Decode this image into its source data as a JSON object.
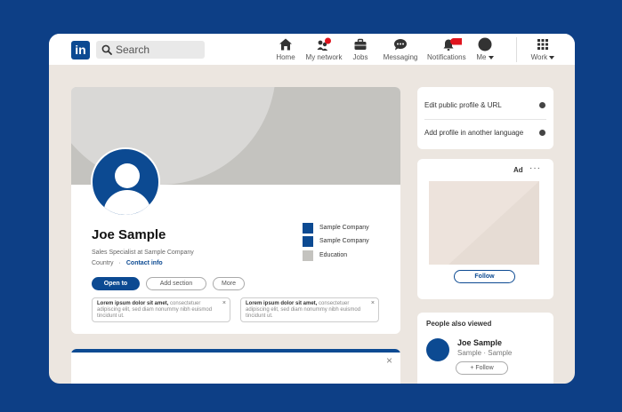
{
  "header": {
    "logo_text": "in",
    "search": {
      "placeholder": "Search"
    },
    "nav": [
      {
        "label": "Home",
        "icon": "home-icon"
      },
      {
        "label": "My network",
        "icon": "network-icon"
      },
      {
        "label": "Jobs",
        "icon": "briefcase-icon"
      },
      {
        "label": "Messaging",
        "icon": "messaging-icon"
      },
      {
        "label": "Notifications",
        "icon": "bell-icon"
      },
      {
        "label": "Me",
        "icon": "avatar-icon"
      },
      {
        "label": "Work",
        "icon": "grid-icon"
      }
    ]
  },
  "profile": {
    "name": "Joe Sample",
    "headline": "Sales Specialist at Sample Company",
    "location": "Country",
    "separator": "·",
    "contact_link": "Contact info",
    "buttons": {
      "open_to": "Open to",
      "add_section": "Add section",
      "more": "More"
    },
    "companies": [
      {
        "label": "Sample Company",
        "color": "#0c4a92"
      },
      {
        "label": "Sample Company",
        "color": "#0c4a92"
      },
      {
        "label": "Education",
        "color": "#c4c3bf"
      }
    ],
    "info_boxes": [
      {
        "bold": "Lorem ipsum dolor sit amet,",
        "text": "consectetuer adipiscing elit, sed diam nonummy nibh euismod tincidunt ut.",
        "close": "×"
      },
      {
        "bold": "Lorem ipsum dolor sit amet,",
        "text": "consectetuer adipiscing elit, sed diam nonummy nibh euismod tincidunt ut.",
        "close": "×"
      }
    ]
  },
  "bottom_card": {
    "close": "×"
  },
  "sidebar": {
    "links": [
      {
        "label": "Edit public profile & URL"
      },
      {
        "label": "Add profile in another language"
      }
    ],
    "ad": {
      "label": "Ad",
      "menu": "···",
      "follow": "Follow"
    },
    "people": {
      "title": "People also viewed",
      "name": "Joe Sample",
      "subtitle": "Sample · Sample",
      "follow": "+ Follow"
    }
  },
  "colors": {
    "brand": "#0c4a92",
    "notification_badge": "#e0141e",
    "frame": "#0d3f86",
    "canvas": "#ece6e0"
  }
}
